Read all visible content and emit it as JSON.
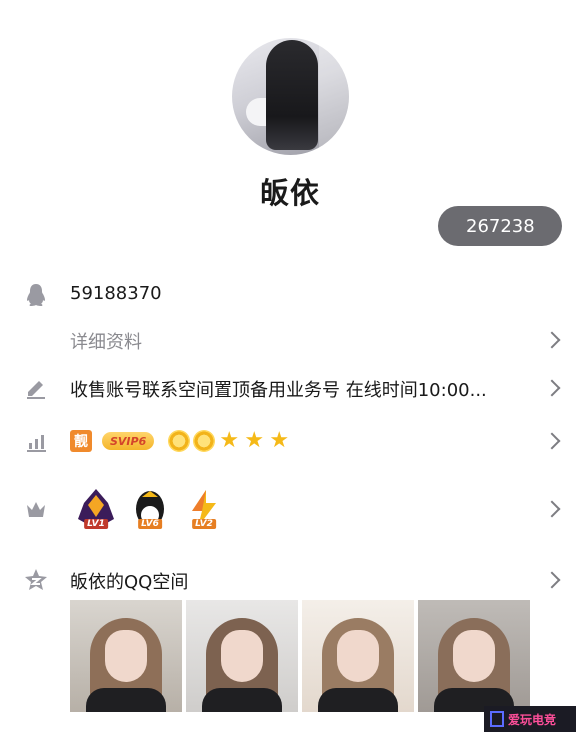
{
  "profile": {
    "nickname": "皈依",
    "likes": "267238"
  },
  "info": {
    "qq_number": "59188370",
    "detail_label": "详细资料",
    "signature": "收售账号联系空间置顶备用业务号 在线时间10:00..."
  },
  "badges": {
    "liang": "靓",
    "svip": "SVIP6",
    "levels": [
      "LV1",
      "LV6",
      "LV2"
    ]
  },
  "qzone": {
    "title": "皈依的QQ空间"
  },
  "watermark": {
    "text": "爱玩电竞"
  },
  "colors": {
    "likes_bg": "#6b6b70",
    "icon": "#9a9aa2",
    "accent_star": "#f5b918"
  },
  "icons": [
    "qq-penguin-icon",
    "pencil-icon",
    "chart-icon",
    "crown-icon",
    "qzone-star-icon",
    "chevron-right-icon"
  ]
}
